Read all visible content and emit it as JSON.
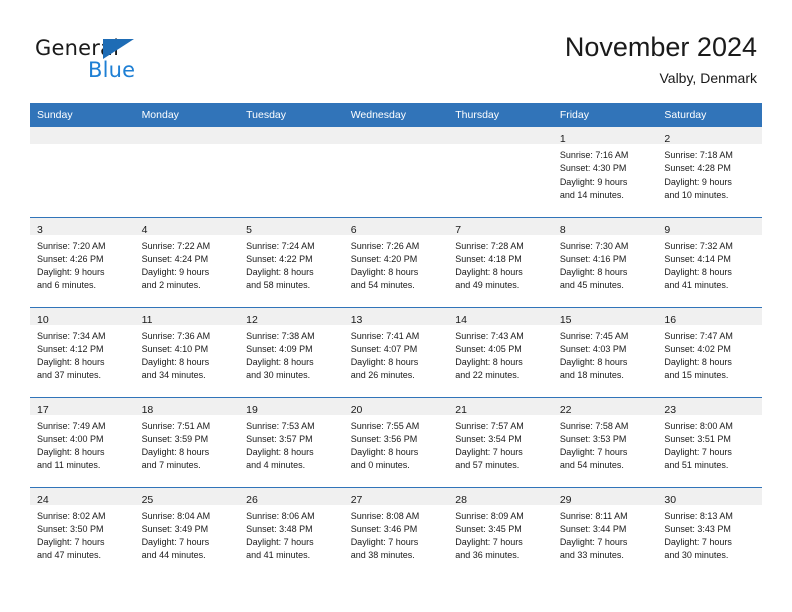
{
  "brand": {
    "name_part1": "General",
    "name_part2": "Blue",
    "accent_color": "#1e7fd4",
    "triangle_color": "#1e6cb5"
  },
  "header": {
    "title": "November 2024",
    "subtitle": "Valby, Denmark",
    "header_bg": "#3174b9",
    "daynum_strip_bg": "#f0f0f0"
  },
  "weekday_headers": [
    "Sunday",
    "Monday",
    "Tuesday",
    "Wednesday",
    "Thursday",
    "Friday",
    "Saturday"
  ],
  "weeks": [
    [
      {
        "day": "",
        "lines": []
      },
      {
        "day": "",
        "lines": []
      },
      {
        "day": "",
        "lines": []
      },
      {
        "day": "",
        "lines": []
      },
      {
        "day": "",
        "lines": []
      },
      {
        "day": "1",
        "lines": [
          "Sunrise: 7:16 AM",
          "Sunset: 4:30 PM",
          "Daylight: 9 hours",
          "and 14 minutes."
        ]
      },
      {
        "day": "2",
        "lines": [
          "Sunrise: 7:18 AM",
          "Sunset: 4:28 PM",
          "Daylight: 9 hours",
          "and 10 minutes."
        ]
      }
    ],
    [
      {
        "day": "3",
        "lines": [
          "Sunrise: 7:20 AM",
          "Sunset: 4:26 PM",
          "Daylight: 9 hours",
          "and 6 minutes."
        ]
      },
      {
        "day": "4",
        "lines": [
          "Sunrise: 7:22 AM",
          "Sunset: 4:24 PM",
          "Daylight: 9 hours",
          "and 2 minutes."
        ]
      },
      {
        "day": "5",
        "lines": [
          "Sunrise: 7:24 AM",
          "Sunset: 4:22 PM",
          "Daylight: 8 hours",
          "and 58 minutes."
        ]
      },
      {
        "day": "6",
        "lines": [
          "Sunrise: 7:26 AM",
          "Sunset: 4:20 PM",
          "Daylight: 8 hours",
          "and 54 minutes."
        ]
      },
      {
        "day": "7",
        "lines": [
          "Sunrise: 7:28 AM",
          "Sunset: 4:18 PM",
          "Daylight: 8 hours",
          "and 49 minutes."
        ]
      },
      {
        "day": "8",
        "lines": [
          "Sunrise: 7:30 AM",
          "Sunset: 4:16 PM",
          "Daylight: 8 hours",
          "and 45 minutes."
        ]
      },
      {
        "day": "9",
        "lines": [
          "Sunrise: 7:32 AM",
          "Sunset: 4:14 PM",
          "Daylight: 8 hours",
          "and 41 minutes."
        ]
      }
    ],
    [
      {
        "day": "10",
        "lines": [
          "Sunrise: 7:34 AM",
          "Sunset: 4:12 PM",
          "Daylight: 8 hours",
          "and 37 minutes."
        ]
      },
      {
        "day": "11",
        "lines": [
          "Sunrise: 7:36 AM",
          "Sunset: 4:10 PM",
          "Daylight: 8 hours",
          "and 34 minutes."
        ]
      },
      {
        "day": "12",
        "lines": [
          "Sunrise: 7:38 AM",
          "Sunset: 4:09 PM",
          "Daylight: 8 hours",
          "and 30 minutes."
        ]
      },
      {
        "day": "13",
        "lines": [
          "Sunrise: 7:41 AM",
          "Sunset: 4:07 PM",
          "Daylight: 8 hours",
          "and 26 minutes."
        ]
      },
      {
        "day": "14",
        "lines": [
          "Sunrise: 7:43 AM",
          "Sunset: 4:05 PM",
          "Daylight: 8 hours",
          "and 22 minutes."
        ]
      },
      {
        "day": "15",
        "lines": [
          "Sunrise: 7:45 AM",
          "Sunset: 4:03 PM",
          "Daylight: 8 hours",
          "and 18 minutes."
        ]
      },
      {
        "day": "16",
        "lines": [
          "Sunrise: 7:47 AM",
          "Sunset: 4:02 PM",
          "Daylight: 8 hours",
          "and 15 minutes."
        ]
      }
    ],
    [
      {
        "day": "17",
        "lines": [
          "Sunrise: 7:49 AM",
          "Sunset: 4:00 PM",
          "Daylight: 8 hours",
          "and 11 minutes."
        ]
      },
      {
        "day": "18",
        "lines": [
          "Sunrise: 7:51 AM",
          "Sunset: 3:59 PM",
          "Daylight: 8 hours",
          "and 7 minutes."
        ]
      },
      {
        "day": "19",
        "lines": [
          "Sunrise: 7:53 AM",
          "Sunset: 3:57 PM",
          "Daylight: 8 hours",
          "and 4 minutes."
        ]
      },
      {
        "day": "20",
        "lines": [
          "Sunrise: 7:55 AM",
          "Sunset: 3:56 PM",
          "Daylight: 8 hours",
          "and 0 minutes."
        ]
      },
      {
        "day": "21",
        "lines": [
          "Sunrise: 7:57 AM",
          "Sunset: 3:54 PM",
          "Daylight: 7 hours",
          "and 57 minutes."
        ]
      },
      {
        "day": "22",
        "lines": [
          "Sunrise: 7:58 AM",
          "Sunset: 3:53 PM",
          "Daylight: 7 hours",
          "and 54 minutes."
        ]
      },
      {
        "day": "23",
        "lines": [
          "Sunrise: 8:00 AM",
          "Sunset: 3:51 PM",
          "Daylight: 7 hours",
          "and 51 minutes."
        ]
      }
    ],
    [
      {
        "day": "24",
        "lines": [
          "Sunrise: 8:02 AM",
          "Sunset: 3:50 PM",
          "Daylight: 7 hours",
          "and 47 minutes."
        ]
      },
      {
        "day": "25",
        "lines": [
          "Sunrise: 8:04 AM",
          "Sunset: 3:49 PM",
          "Daylight: 7 hours",
          "and 44 minutes."
        ]
      },
      {
        "day": "26",
        "lines": [
          "Sunrise: 8:06 AM",
          "Sunset: 3:48 PM",
          "Daylight: 7 hours",
          "and 41 minutes."
        ]
      },
      {
        "day": "27",
        "lines": [
          "Sunrise: 8:08 AM",
          "Sunset: 3:46 PM",
          "Daylight: 7 hours",
          "and 38 minutes."
        ]
      },
      {
        "day": "28",
        "lines": [
          "Sunrise: 8:09 AM",
          "Sunset: 3:45 PM",
          "Daylight: 7 hours",
          "and 36 minutes."
        ]
      },
      {
        "day": "29",
        "lines": [
          "Sunrise: 8:11 AM",
          "Sunset: 3:44 PM",
          "Daylight: 7 hours",
          "and 33 minutes."
        ]
      },
      {
        "day": "30",
        "lines": [
          "Sunrise: 8:13 AM",
          "Sunset: 3:43 PM",
          "Daylight: 7 hours",
          "and 30 minutes."
        ]
      }
    ]
  ]
}
